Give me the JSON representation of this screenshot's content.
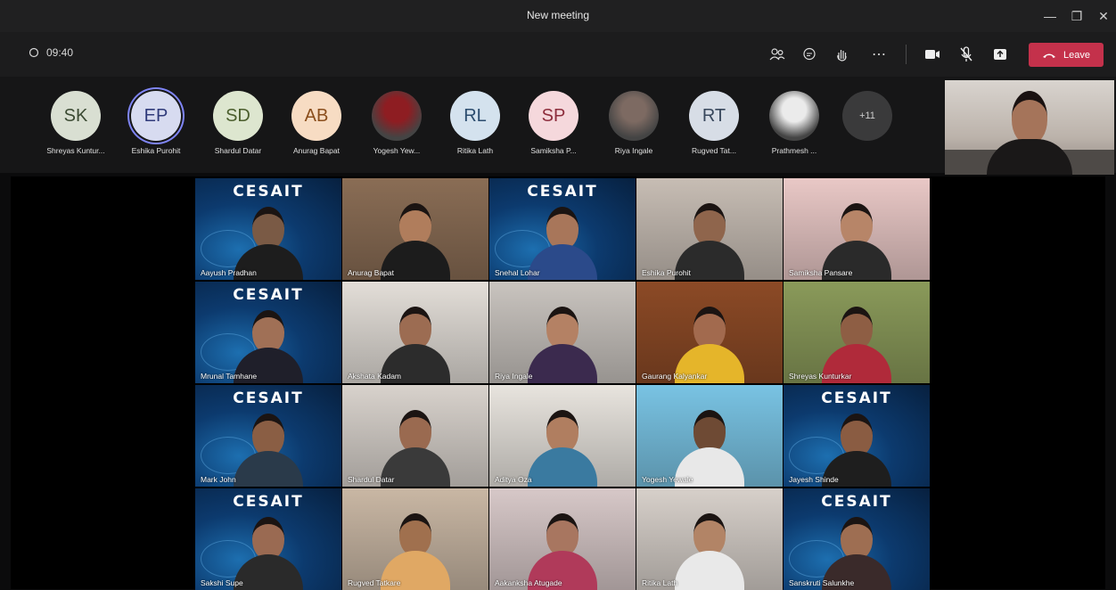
{
  "window": {
    "title": "New meeting",
    "min_icon": "minimize-icon",
    "max_icon": "maximize-icon",
    "close_icon": "close-icon"
  },
  "toolbar": {
    "timer": "09:40",
    "buttons": [
      "people-icon",
      "chat-icon",
      "raise-hand-icon",
      "more-icon",
      "camera-icon",
      "mic-off-icon",
      "share-tray-icon"
    ],
    "leave_label": "Leave"
  },
  "strip": {
    "participants": [
      {
        "initials": "SK",
        "name": "Shreyas Kuntur...",
        "bg": "#d9dfd2",
        "fg": "#3b4a33",
        "type": "initials"
      },
      {
        "initials": "EP",
        "name": "Eshika Purohit",
        "bg": "#d7dbf0",
        "fg": "#2f3a7a",
        "type": "initials",
        "speaking": true
      },
      {
        "initials": "SD",
        "name": "Shardul Datar",
        "bg": "#dde6cf",
        "fg": "#4b5e2d",
        "type": "initials"
      },
      {
        "initials": "AB",
        "name": "Anurag Bapat",
        "bg": "#f7dcc3",
        "fg": "#8a4e1c",
        "type": "initials"
      },
      {
        "initials": "",
        "name": "Yogesh Yew...",
        "bg": "#8e1d22",
        "fg": "#fff",
        "type": "photo"
      },
      {
        "initials": "RL",
        "name": "Ritika Lath",
        "bg": "#d4e2ee",
        "fg": "#2b4c6e",
        "type": "initials"
      },
      {
        "initials": "SP",
        "name": "Samiksha P...",
        "bg": "#f5d8dc",
        "fg": "#8d2d3c",
        "type": "initials"
      },
      {
        "initials": "",
        "name": "Riya Ingale",
        "bg": "#7d6a62",
        "fg": "#fff",
        "type": "photo"
      },
      {
        "initials": "RT",
        "name": "Rugved Tat...",
        "bg": "#d7dde6",
        "fg": "#38475c",
        "type": "initials"
      },
      {
        "initials": "",
        "name": "Prathmesh ...",
        "bg": "#ebebeb",
        "fg": "#333",
        "type": "photo"
      },
      {
        "initials": "+11",
        "name": "",
        "bg": "#3a3a3b",
        "fg": "#d0d0d0",
        "type": "overflow"
      }
    ]
  },
  "grid": {
    "logo_text": "CESAIT",
    "tiles": [
      {
        "name": "Aayush Pradhan",
        "bg": "cesa",
        "skin": "#7a5a45",
        "shirt": "#1d1d1d"
      },
      {
        "name": "Anurag Bapat",
        "bg": "#8a6d55",
        "skin": "#b07d5c",
        "shirt": "#1c1c1c"
      },
      {
        "name": "Snehal Lohar",
        "bg": "cesa",
        "skin": "#a8765a",
        "shirt": "#2b4a8a"
      },
      {
        "name": "Eshika Purohit",
        "bg": "#c7bdb4",
        "skin": "#8f654c",
        "shirt": "#2b2b2b"
      },
      {
        "name": "Samiksha Pansare",
        "bg": "#e9c8c6",
        "skin": "#b78568",
        "shirt": "#2a2a2a"
      },
      {
        "name": "Mrunal Tamhane",
        "bg": "cesa",
        "skin": "#a07056",
        "shirt": "#1f1f2a"
      },
      {
        "name": "Akshata Kadam",
        "bg": "#e3ded8",
        "skin": "#9c6c52",
        "shirt": "#2c2c2c"
      },
      {
        "name": "Riya Ingale",
        "bg": "#c9c4bf",
        "skin": "#b48164",
        "shirt": "#3b2a4e"
      },
      {
        "name": "Gaurang Kalyankar",
        "bg": "#8c4a26",
        "skin": "#a26a4e",
        "shirt": "#e5b52a"
      },
      {
        "name": "Shreyas Kunturkar",
        "bg": "#8a9a5a",
        "skin": "#8e5e44",
        "shirt": "#b02a3a"
      },
      {
        "name": "Mark John",
        "bg": "cesa",
        "skin": "#8a5e44",
        "shirt": "#2a3a4a"
      },
      {
        "name": "Shardul Datar",
        "bg": "#d8d2cc",
        "skin": "#9a6a50",
        "shirt": "#3a3a3a"
      },
      {
        "name": "Aditya Oza",
        "bg": "#e8e4de",
        "skin": "#b07e60",
        "shirt": "#3a7aa0"
      },
      {
        "name": "Yogesh Yewale",
        "bg": "#79c3e3",
        "skin": "#6e4a34",
        "shirt": "#e8e8e8"
      },
      {
        "name": "Jayesh Shinde",
        "bg": "cesa",
        "skin": "#8a5c42",
        "shirt": "#1e1e1e"
      },
      {
        "name": "Sakshi Supe",
        "bg": "cesa",
        "skin": "#9a6a52",
        "shirt": "#2a2a2a"
      },
      {
        "name": "Rugved Tatkare",
        "bg": "#c9b7a4",
        "skin": "#a0704e",
        "shirt": "#e0a864"
      },
      {
        "name": "Aakanksha Atugade",
        "bg": "#d7c8c8",
        "skin": "#a87660",
        "shirt": "#b03a5a"
      },
      {
        "name": "Ritika Lath",
        "bg": "#d7d0ca",
        "skin": "#b28466",
        "shirt": "#e9e9e9"
      },
      {
        "name": "Sanskruti Salunkhe",
        "bg": "cesa",
        "skin": "#9e6e52",
        "shirt": "#3a2a2a"
      }
    ]
  }
}
